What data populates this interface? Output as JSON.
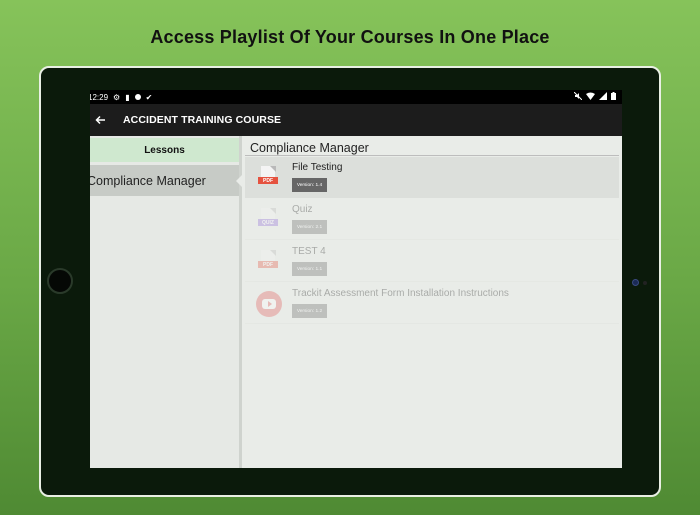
{
  "headline": "Access Playlist Of Your Courses In One Place",
  "status_bar": {
    "time": "12:29",
    "left_icons": [
      "gear-icon",
      "battery-saver-icon",
      "circle-icon",
      "check-icon"
    ],
    "right_icons": [
      "mute-icon",
      "wifi-icon",
      "signal-icon",
      "battery-icon"
    ]
  },
  "app_bar": {
    "back_icon": "arrow-left-icon",
    "title": "ACCIDENT TRAINING COURSE"
  },
  "lessons": {
    "header": "Lessons",
    "items": [
      {
        "label": "Compliance Manager",
        "selected": true
      }
    ]
  },
  "section": {
    "title": "Compliance Manager",
    "items": [
      {
        "name": "File Testing",
        "type": "PDF",
        "version": "Version: 1.4",
        "enabled": true
      },
      {
        "name": "Quiz",
        "type": "QUIZ",
        "version": "Version: 2.1",
        "enabled": false
      },
      {
        "name": "TEST 4",
        "type": "PDF",
        "version": "Version: 1.1",
        "enabled": false
      },
      {
        "name": "Trackit Assessment Form Installation Instructions",
        "type": "VIDEO",
        "version": "Version: 1.2",
        "enabled": false
      }
    ]
  },
  "colors": {
    "background_green": "#6aa846",
    "lessons_header": "#cfe8cf",
    "pdf_tag": "#e5523f",
    "quiz_tag": "#8e6ad6",
    "video_icon": "#e05555",
    "app_bar": "#1c1c1c"
  }
}
